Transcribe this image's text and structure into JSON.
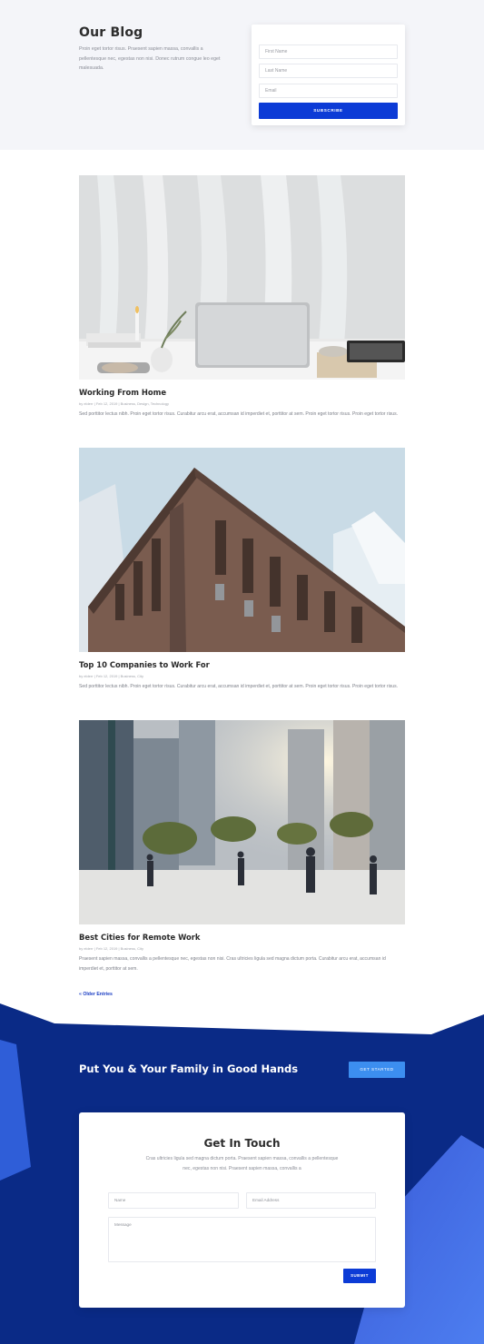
{
  "hero": {
    "title": "Our Blog",
    "description": "Proin eget tortor risus. Praesent sapien massa, convallis a pellentesque nec, egestas non nisi. Donec rutrum congue leo eget malesuada."
  },
  "subscribe": {
    "first_name_placeholder": "First Name",
    "last_name_placeholder": "Last Name",
    "email_placeholder": "Email",
    "button_label": "SUBSCRIBE"
  },
  "posts": [
    {
      "title": "Working From Home",
      "meta": "by elderr | Feb 12, 2019 | Business, Design, Technology",
      "excerpt": "Sed porttitor lectus nibh. Proin eget tortor risus. Curabitur arcu erat, accumsan id imperdiet et, porttitor at sem. Proin eget tortor risus. Proin eget tortor risus."
    },
    {
      "title": "Top 10 Companies to Work For",
      "meta": "by elderr | Feb 12, 2019 | Business, City",
      "excerpt": "Sed porttitor lectus nibh. Proin eget tortor risus. Curabitur arcu erat, accumsan id imperdiet et, porttitor at sem. Proin eget tortor risus. Proin eget tortor risus."
    },
    {
      "title": "Best Cities for Remote Work",
      "meta": "by elderr | Feb 12, 2019 | Business, City",
      "excerpt": "Praesent sapien massa, convallis a pellentesque nec, egestas non nisi. Cras ultricies ligula sed magna dictum porta. Curabitur arcu erat, accumsan id imperdiet et, porttitor at sem."
    }
  ],
  "pagination": {
    "older_label": "« Older Entries"
  },
  "cta": {
    "title": "Put You & Your Family in Good Hands",
    "button_label": "GET STARTED"
  },
  "contact": {
    "title": "Get In Touch",
    "description": "Cras ultricies ligula sed magna dictum porta. Praesent sapien massa, convallis a pellentesque nec, egestas non nisi. Praesent sapien massa, convallis a",
    "name_placeholder": "Name",
    "email_placeholder": "Email Address",
    "message_placeholder": "Message",
    "submit_label": "SUBMIT"
  },
  "colors": {
    "primary": "#0c3bd6",
    "footer_navy": "#0a2a86",
    "cta_button": "#3c8ef0",
    "hero_bg": "#f4f5f9"
  }
}
